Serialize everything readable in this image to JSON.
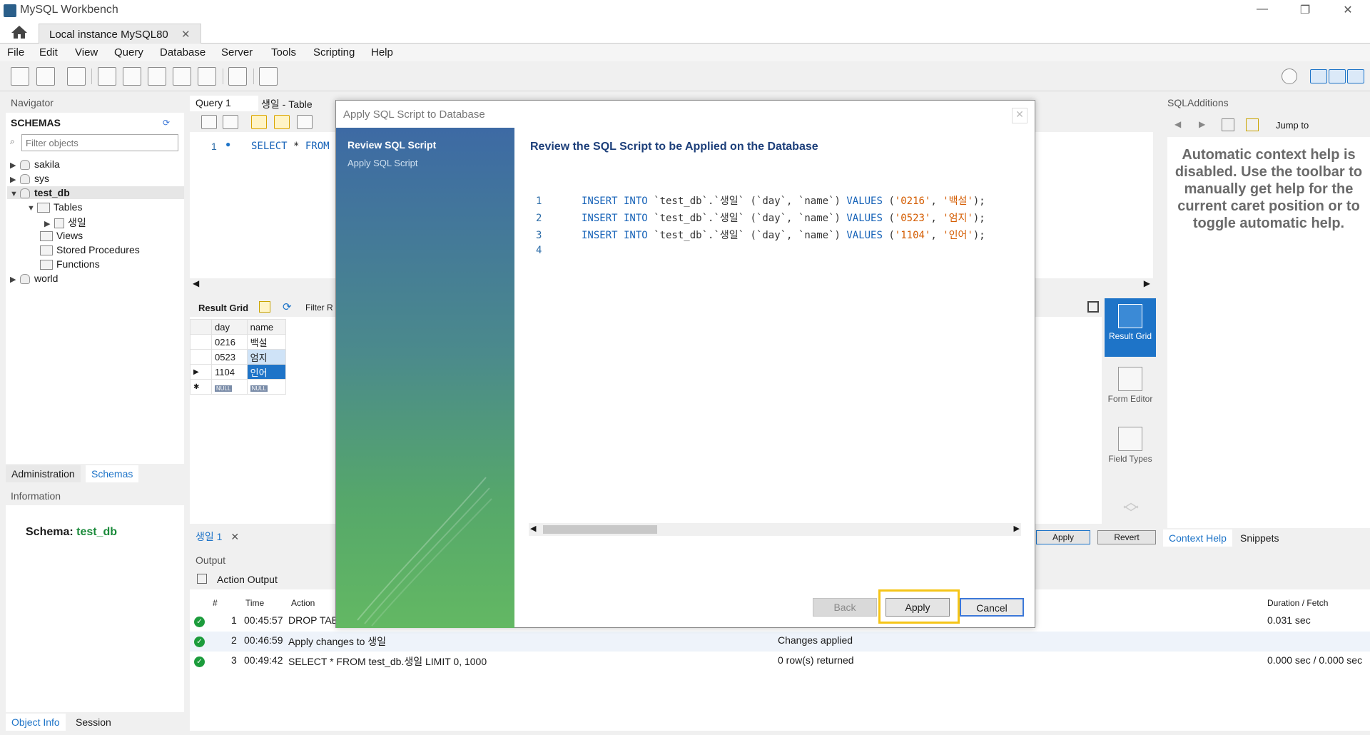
{
  "window": {
    "title": "MySQL Workbench",
    "minimize": "—",
    "restore": "❐",
    "close": "✕"
  },
  "tabs": {
    "connection": "Local instance MySQL80",
    "close": "✕"
  },
  "menu": [
    "File",
    "Edit",
    "View",
    "Query",
    "Database",
    "Server",
    "Tools",
    "Scripting",
    "Help"
  ],
  "navigator": {
    "title": "Navigator",
    "schemas_label": "SCHEMAS",
    "filter_placeholder": "Filter objects",
    "tree": {
      "sakila": "sakila",
      "sys": "sys",
      "test_db": "test_db",
      "tables": "Tables",
      "table_item": "생일",
      "views": "Views",
      "stored_procedures": "Stored Procedures",
      "functions": "Functions",
      "world": "world"
    },
    "tabs": {
      "administration": "Administration",
      "schemas": "Schemas"
    },
    "information_title": "Information",
    "schema_label": "Schema:",
    "schema_value": "test_db",
    "bottom_tabs": {
      "object_info": "Object Info",
      "session": "Session"
    }
  },
  "editor_tabs": {
    "query1": "Query 1",
    "table_tab": "생일 - Table"
  },
  "editor": {
    "line_no": "1",
    "code_kw": "SELECT",
    "code_rest": " * ",
    "code_from": "FROM"
  },
  "result": {
    "result_grid": "Result Grid",
    "filter_rows": "Filter R",
    "columns": [
      "day",
      "name"
    ],
    "rows": [
      [
        "0216",
        "백설"
      ],
      [
        "0523",
        "엄지"
      ],
      [
        "1104",
        "인어"
      ]
    ],
    "null_label": "NULL",
    "tab_label": "생일 1",
    "apply": "Apply",
    "revert": "Revert"
  },
  "side_tabs": {
    "result_grid": "Result Grid",
    "form_editor": "Form Editor",
    "field_types": "Field Types"
  },
  "sql_additions": {
    "title": "SQLAdditions",
    "jump_to": "Jump to",
    "help_text": "Automatic context help is disabled. Use the toolbar to manually get help for the current caret position or to toggle automatic help.",
    "context_help": "Context Help",
    "snippets": "Snippets"
  },
  "output": {
    "title": "Output",
    "action_output": "Action Output",
    "columns": {
      "num": "#",
      "time": "Time",
      "action": "Action",
      "duration": "Duration / Fetch"
    },
    "rows": [
      {
        "num": "1",
        "time": "00:45:57",
        "action": "DROP TAB",
        "message": "",
        "duration": "0.031 sec"
      },
      {
        "num": "2",
        "time": "00:46:59",
        "action": "Apply changes to 생일",
        "message": "Changes applied",
        "duration": ""
      },
      {
        "num": "3",
        "time": "00:49:42",
        "action": "SELECT * FROM test_db.생일 LIMIT 0, 1000",
        "message": "0 row(s) returned",
        "duration": "0.000 sec / 0.000 sec"
      }
    ]
  },
  "dialog": {
    "title": "Apply SQL Script to Database",
    "steps": [
      "Review SQL Script",
      "Apply SQL Script"
    ],
    "heading": "Review the SQL Script to be Applied on the Database",
    "lines": [
      {
        "n": "1",
        "kw1": "INSERT INTO",
        "mid": " `test_db`.`생일` (`day`, `name`) ",
        "kw2": "VALUES",
        "open": " (",
        "v1": "'0216'",
        "comma": ", ",
        "v2": "'백설'",
        "close": ");"
      },
      {
        "n": "2",
        "kw1": "INSERT INTO",
        "mid": " `test_db`.`생일` (`day`, `name`) ",
        "kw2": "VALUES",
        "open": " (",
        "v1": "'0523'",
        "comma": ", ",
        "v2": "'엄지'",
        "close": ");"
      },
      {
        "n": "3",
        "kw1": "INSERT INTO",
        "mid": " `test_db`.`생일` (`day`, `name`) ",
        "kw2": "VALUES",
        "open": " (",
        "v1": "'1104'",
        "comma": ", ",
        "v2": "'인어'",
        "close": ");"
      },
      {
        "n": "4"
      }
    ],
    "back": "Back",
    "apply": "Apply",
    "cancel": "Cancel"
  }
}
